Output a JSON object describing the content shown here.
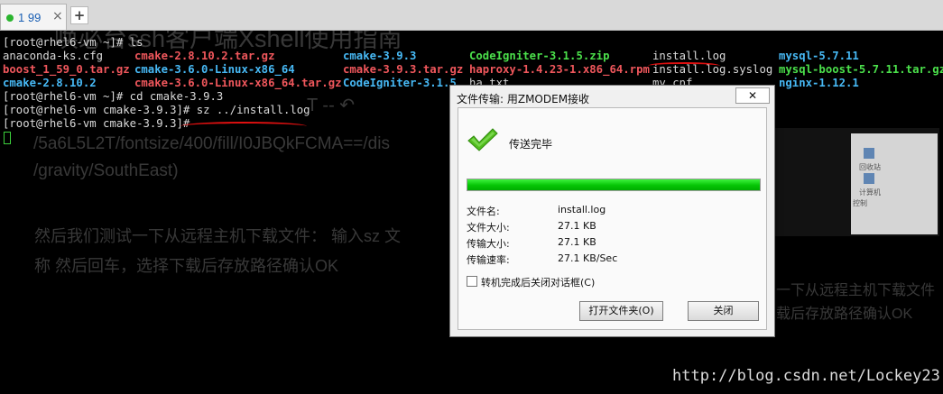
{
  "tabs": [
    {
      "label": "1 99",
      "close": "×",
      "status_color": "#2bb52f"
    }
  ],
  "new_tab_label": "+",
  "background_ghost_text": {
    "heading": "唤必台ssh客户端Xshell使用指南",
    "toolbar_glyphs": "T  --  ↶",
    "url_line1": "/5a6L5L2T/fontsize/400/fill/I0JBQkFCMA==/dis",
    "url_line2": "/gravity/SouthEast)",
    "para_line1": "然后我们测试一下从远程主机下载文件： 输入sz 文",
    "para_line2": "称 然后回车，选择下载后存放路径确认OK",
    "right_line1": "一下从远程主机下载文件",
    "right_line2": "载后存放路径确认OK",
    "right_img_labels": [
      "控制",
      "回收站",
      "计算机"
    ]
  },
  "terminal": {
    "prompt_ls": "[root@rhel6-vm ~]# ls",
    "ls_rows": [
      [
        "anaconda-ks.cfg",
        "cmake-2.8.10.2.tar.gz",
        "cmake-3.9.3",
        "CodeIgniter-3.1.5.zip",
        "install.log",
        "mysql-5.7.11"
      ],
      [
        "boost_1_59_0.tar.gz",
        "cmake-3.6.0-Linux-x86_64",
        "cmake-3.9.3.tar.gz",
        "haproxy-1.4.23-1.x86_64.rpm",
        "install.log.syslog",
        "mysql-boost-5.7.11.tar.gz"
      ],
      [
        "cmake-2.8.10.2",
        "cmake-3.6.0-Linux-x86_64.tar.gz",
        "CodeIgniter-3.1.5",
        "ha.txt",
        "my.cnf",
        "nginx-1.12.1"
      ]
    ],
    "cmd_cd": "[root@rhel6-vm ~]# cd cmake-3.9.3",
    "cmd_sz": "[root@rhel6-vm cmake-3.9.3]# sz ../install.log",
    "prompt_last": "[root@rhel6-vm cmake-3.9.3]#",
    "colors": {
      "file": "#dadada",
      "archive": "#f0575c",
      "dir": "#47b9f5",
      "exec": "#4be04b"
    }
  },
  "watermark": "http://blog.csdn.net/Lockey23",
  "dialog": {
    "title": "文件传输: 用ZMODEM接收",
    "close_label": "关闭",
    "status": "传送完毕",
    "progress": 1.0,
    "fields": [
      {
        "label": "文件名:",
        "value": "install.log"
      },
      {
        "label": "文件大小:",
        "value": "27.1 KB"
      },
      {
        "label": "传输大小:",
        "value": "27.1 KB"
      },
      {
        "label": "传输速率:",
        "value": "27.1 KB/Sec"
      }
    ],
    "checkbox_label": "转机完成后关闭对话框(C)",
    "checkbox_checked": false,
    "open_folder_label": "打开文件夹(O)",
    "close_button_label": "关闭"
  }
}
